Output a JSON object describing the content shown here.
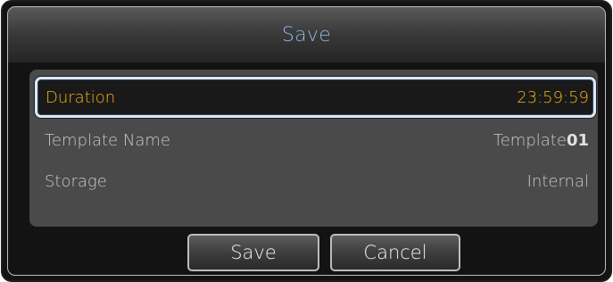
{
  "dialog": {
    "title": "Save"
  },
  "settings": [
    {
      "label": "Duration",
      "value": "23:59:59"
    },
    {
      "label": "Template Name",
      "value_prefix": "Template",
      "value_number": "01"
    },
    {
      "label": "Storage",
      "value": "Internal"
    }
  ],
  "buttons": {
    "save_label": "Save",
    "cancel_label": "Cancel"
  },
  "colors": {
    "selected_text": "#f0b418",
    "title_text": "#8fb3de",
    "panel_bg": "#4a4a4a"
  }
}
